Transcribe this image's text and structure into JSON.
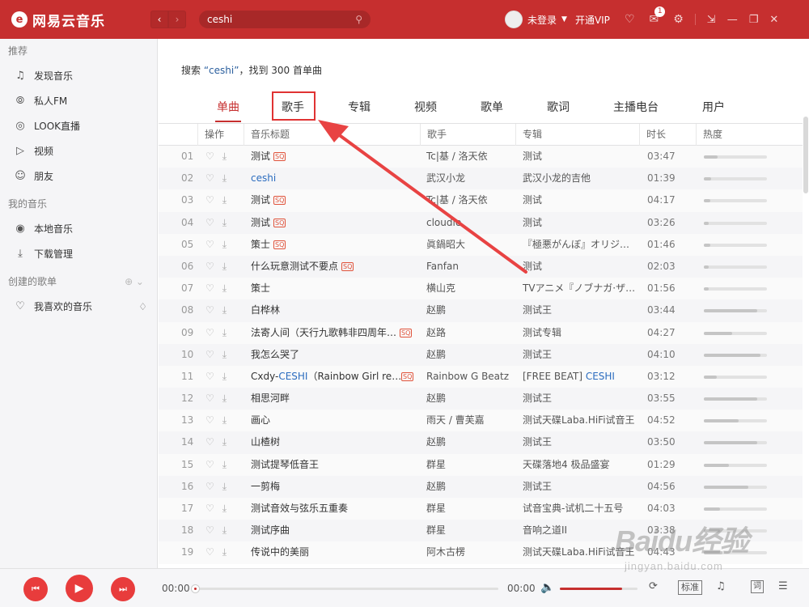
{
  "app": {
    "logo_text": "网易云音乐",
    "logo_glyph": "e"
  },
  "header": {
    "nav_back": "‹",
    "nav_forward": "›",
    "search_value": "ceshi",
    "user_label": "未登录",
    "vip_label": "开通VIP",
    "message_badge": "1"
  },
  "sidebar": {
    "recommend_label": "推荐",
    "recommend_items": [
      {
        "label": "发现音乐",
        "icon": "music-note-icon"
      },
      {
        "label": "私人FM",
        "icon": "radio-icon"
      },
      {
        "label": "LOOK直播",
        "icon": "live-icon"
      },
      {
        "label": "视频",
        "icon": "video-icon"
      },
      {
        "label": "朋友",
        "icon": "friends-icon"
      }
    ],
    "my_music_label": "我的音乐",
    "my_music_items": [
      {
        "label": "本地音乐",
        "icon": "local-music-icon"
      },
      {
        "label": "下载管理",
        "icon": "download-icon"
      }
    ],
    "created_playlists_label": "创建的歌单",
    "playlists": [
      {
        "label": "我喜欢的音乐",
        "icon": "heart-icon"
      }
    ]
  },
  "search": {
    "result_prefix": "搜索 ",
    "result_query": "“ceshi”",
    "result_suffix": "，找到 300 首单曲"
  },
  "tabs": [
    "单曲",
    "歌手",
    "专辑",
    "视频",
    "歌单",
    "歌词",
    "主播电台",
    "用户"
  ],
  "active_tab": "单曲",
  "table": {
    "headers": {
      "ops": "操作",
      "title": "音乐标题",
      "artist": "歌手",
      "album": "专辑",
      "duration": "时长",
      "heat": "热度"
    },
    "rows": [
      {
        "no": "01",
        "title": "测试",
        "sq": true,
        "artist": "Tc|基 / 洛天依",
        "album": "测试",
        "duration": "03:47",
        "heat": 0.22
      },
      {
        "no": "02",
        "title": "ceshi",
        "title_hl": true,
        "sq": false,
        "artist": "武汉小龙",
        "album": "武汉小龙的吉他",
        "duration": "01:39",
        "heat": 0.12
      },
      {
        "no": "03",
        "title": "测试",
        "sq": true,
        "artist": "Tc|基 / 洛天依",
        "album": "测试",
        "duration": "04:17",
        "heat": 0.1
      },
      {
        "no": "04",
        "title": "测试",
        "sq": true,
        "artist": "cloudie",
        "album": "测试",
        "duration": "03:26",
        "heat": 0.08
      },
      {
        "no": "05",
        "title": "策士",
        "sq": true,
        "artist": "眞鍋昭大",
        "album": "『極悪がんぼ』オリジ…",
        "duration": "01:46",
        "heat": 0.1
      },
      {
        "no": "06",
        "title": "什么玩意测试不要点",
        "sq": true,
        "artist": "Fanfan",
        "album": "测试",
        "duration": "02:03",
        "heat": 0.08
      },
      {
        "no": "07",
        "title": "策士",
        "sq": false,
        "artist": "横山克",
        "album": "TVアニメ『ノブナガ·ザ…",
        "duration": "01:56",
        "heat": 0.08
      },
      {
        "no": "08",
        "title": "白桦林",
        "sq": false,
        "artist": "赵鹏",
        "album": "测试王",
        "duration": "03:44",
        "heat": 0.85
      },
      {
        "no": "09",
        "title": "法寄人间（天行九歌韩非四周年…",
        "sq": true,
        "artist": "赵路",
        "album": "测试专辑",
        "duration": "04:27",
        "heat": 0.45
      },
      {
        "no": "10",
        "title": "我怎么哭了",
        "sq": false,
        "artist": "赵鹏",
        "album": "测试王",
        "duration": "04:10",
        "heat": 0.9
      },
      {
        "no": "11",
        "title_parts": [
          "Cxdy-",
          "CESHI",
          "（Rainbow Girl re…"
        ],
        "title": "Cxdy-CESHI（Rainbow Girl re…",
        "sq": true,
        "artist": "Rainbow G Beatz",
        "album_parts": [
          "[FREE BEAT] ",
          "CESHI"
        ],
        "album": "[FREE BEAT] CESHI",
        "duration": "03:12",
        "heat": 0.2
      },
      {
        "no": "12",
        "title": "相思河畔",
        "sq": false,
        "artist": "赵鹏",
        "album": "测试王",
        "duration": "03:55",
        "heat": 0.85
      },
      {
        "no": "13",
        "title": "画心",
        "sq": false,
        "artist": "雨天 / 曹芙嘉",
        "album": "测试天碟Laba.HiFi试音王",
        "duration": "04:52",
        "heat": 0.55
      },
      {
        "no": "14",
        "title": "山楂树",
        "sq": false,
        "artist": "赵鹏",
        "album": "测试王",
        "duration": "03:50",
        "heat": 0.85
      },
      {
        "no": "15",
        "title": "测试提琴低音王",
        "sq": false,
        "artist": "群星",
        "album": "天碟落地4 极品盛宴",
        "duration": "01:29",
        "heat": 0.4
      },
      {
        "no": "16",
        "title": "一剪梅",
        "sq": false,
        "artist": "赵鹏",
        "album": "测试王",
        "duration": "04:56",
        "heat": 0.7
      },
      {
        "no": "17",
        "title": "测试音效与弦乐五重奏",
        "sq": false,
        "artist": "群星",
        "album": "试音宝典-试机二十五号",
        "duration": "04:03",
        "heat": 0.25
      },
      {
        "no": "18",
        "title": "测试序曲",
        "sq": false,
        "artist": "群星",
        "album": "音响之道II",
        "duration": "03:38",
        "heat": 0.25
      },
      {
        "no": "19",
        "title": "传说中的美丽",
        "sq": false,
        "artist": "阿木古楞",
        "album": "测试天碟Laba.HiFi试音王",
        "duration": "04:43",
        "heat": 0.3
      }
    ]
  },
  "player": {
    "current_time": "00:00",
    "total_time": "00:00",
    "volume": 0.8,
    "quality_label": "标准",
    "lyrics_label": "词"
  },
  "sq_label": "SQ",
  "watermark": {
    "logo": "Baidu经验",
    "sub": "jingyan.baidu.com"
  },
  "colors": {
    "brand": "#c62f2f",
    "highlight_link": "#2b6cbf",
    "annotation": "#e03333"
  }
}
